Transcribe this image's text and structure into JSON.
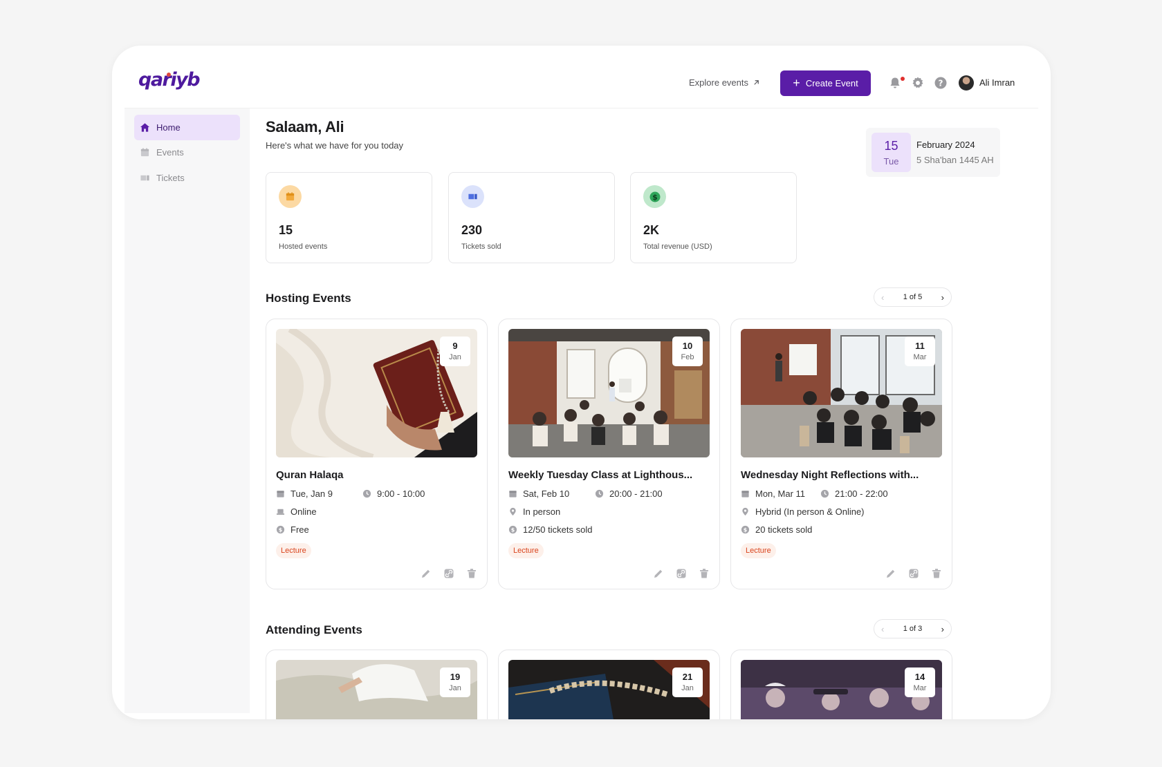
{
  "header": {
    "logo": "qariyb",
    "explore_label": "Explore events",
    "create_label": "Create Event",
    "user_name": "Ali Imran"
  },
  "sidebar": {
    "items": [
      {
        "label": "Home",
        "icon": "home-icon",
        "active": true
      },
      {
        "label": "Events",
        "icon": "calendar-icon",
        "active": false
      },
      {
        "label": "Tickets",
        "icon": "ticket-icon",
        "active": false
      }
    ]
  },
  "main": {
    "greeting": "Salaam, Ali",
    "subtitle": "Here's what we have for you today"
  },
  "date": {
    "day": "15",
    "weekday": "Tue",
    "month_year": "February 2024",
    "hijri": "5 Sha'ban 1445 AH"
  },
  "stats": [
    {
      "value": "15",
      "label": "Hosted events",
      "icon": "calendar-icon",
      "color": "#f2a93b"
    },
    {
      "value": "230",
      "label": "Tickets sold",
      "icon": "ticket-icon",
      "color": "#4f6fe0"
    },
    {
      "value": "2K",
      "label": "Total revenue (USD)",
      "icon": "dollar-icon",
      "color": "#2ea55a"
    }
  ],
  "hosting": {
    "title": "Hosting Events",
    "pager": "1 of 5",
    "events": [
      {
        "day": "9",
        "month": "Jan",
        "title": "Quran Halaqa",
        "date": "Tue, Jan 9",
        "time": "9:00 - 10:00",
        "location": "Online",
        "price": "Free",
        "tag": "Lecture"
      },
      {
        "day": "10",
        "month": "Feb",
        "title": "Weekly Tuesday Class at Lighthous...",
        "date": "Sat, Feb 10",
        "time": "20:00 - 21:00",
        "location": "In person",
        "price": "12/50 tickets sold",
        "tag": "Lecture"
      },
      {
        "day": "11",
        "month": "Mar",
        "title": "Wednesday Night Reflections with...",
        "date": "Mon, Mar 11",
        "time": "21:00 - 22:00",
        "location": "Hybrid (In person & Online)",
        "price": "20 tickets sold",
        "tag": "Lecture"
      }
    ]
  },
  "attending": {
    "title": "Attending Events",
    "pager": "1 of 3",
    "events": [
      {
        "day": "19",
        "month": "Jan"
      },
      {
        "day": "21",
        "month": "Jan"
      },
      {
        "day": "14",
        "month": "Mar"
      }
    ]
  },
  "colors": {
    "brand": "#5a1da7",
    "active_nav_bg": "#ece1fb",
    "tag_text": "#d9431c",
    "tag_bg": "#fdf0ea"
  }
}
